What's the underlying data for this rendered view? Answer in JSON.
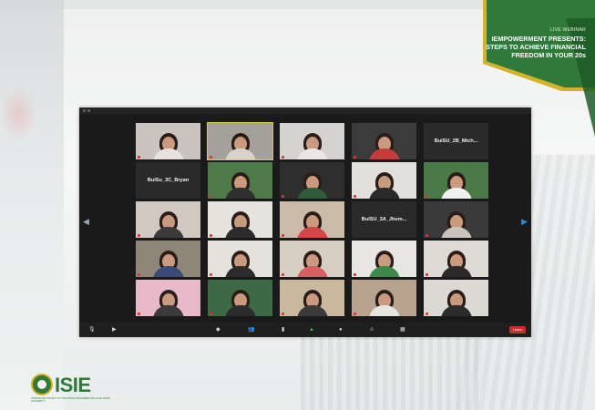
{
  "banner": {
    "kicker": "LIVE WEBINAR",
    "title": "IEMPOWERMENT PRESENTS: STEPS TO ACHIEVE FINANCIAL FREEDOM IN YOUR 20s",
    "colors": {
      "green": "#2f7a39",
      "gold": "#d4b22a"
    }
  },
  "zoom": {
    "tiles": [
      {
        "label": "",
        "kind": "video",
        "bg": "#c9c4bf",
        "shirt": "#e7e2dc"
      },
      {
        "label": "",
        "kind": "video",
        "bg": "#a4a09a",
        "shirt": "#d9d2c8",
        "active": true
      },
      {
        "label": "",
        "kind": "video",
        "bg": "#d5d3cf",
        "shirt": "#e9e7e3"
      },
      {
        "label": "",
        "kind": "video",
        "bg": "#3b3b3b",
        "shirt": "#c43d3d"
      },
      {
        "label": "BulSU_2B_Mich...",
        "kind": "name"
      },
      {
        "label": "BulSu_3C_Bryan",
        "kind": "name"
      },
      {
        "label": "",
        "kind": "video",
        "bg": "#4d7a48",
        "shirt": "#2f2f2f"
      },
      {
        "label": "",
        "kind": "video",
        "bg": "#2e2e2e",
        "shirt": "#2f5c3a"
      },
      {
        "label": "",
        "kind": "video",
        "bg": "#e2e0dc",
        "shirt": "#2a2a2a"
      },
      {
        "label": "",
        "kind": "video",
        "bg": "#4a7a48",
        "shirt": "#f0f0f0"
      },
      {
        "label": "",
        "kind": "video",
        "bg": "#d3c8bf",
        "shirt": "#3a3a3a"
      },
      {
        "label": "",
        "kind": "video",
        "bg": "#e6e3de",
        "shirt": "#2b2b2b"
      },
      {
        "label": "",
        "kind": "video",
        "bg": "#c9bba8",
        "shirt": "#d14848"
      },
      {
        "label": "BulSU_3A_Jhem...",
        "kind": "name"
      },
      {
        "label": "",
        "kind": "video",
        "bg": "#3a3a3a",
        "shirt": "#c9c4bd"
      },
      {
        "label": "",
        "kind": "video",
        "bg": "#8f8679",
        "shirt": "#3a4a7a"
      },
      {
        "label": "",
        "kind": "video",
        "bg": "#e5e2dd",
        "shirt": "#2b2b2b"
      },
      {
        "label": "",
        "kind": "video",
        "bg": "#d8cfc4",
        "shirt": "#d85f5f"
      },
      {
        "label": "",
        "kind": "video",
        "bg": "#e8e6e2",
        "shirt": "#3c8a4a"
      },
      {
        "label": "",
        "kind": "video",
        "bg": "#dedbd6",
        "shirt": "#2a2a2a"
      },
      {
        "label": "",
        "kind": "video",
        "bg": "#e7b9c9",
        "shirt": "#3a3a3a"
      },
      {
        "label": "",
        "kind": "video",
        "bg": "#3d6a45",
        "shirt": "#2b2b2b"
      },
      {
        "label": "",
        "kind": "video",
        "bg": "#c7b89e",
        "shirt": "#3a3a3a"
      },
      {
        "label": "",
        "kind": "video",
        "bg": "#b8a38f",
        "shirt": "#e8e4df"
      },
      {
        "label": "",
        "kind": "video",
        "bg": "#dcd8d2",
        "shirt": "#2b2b2b"
      }
    ],
    "end_label": "Leave"
  },
  "logo": {
    "word": "ISIE",
    "subtitle": "INTEGRATED SOCIETY OF INDUSTRIAL ENGINEERS BULACAN STATE UNIVERSITY"
  }
}
